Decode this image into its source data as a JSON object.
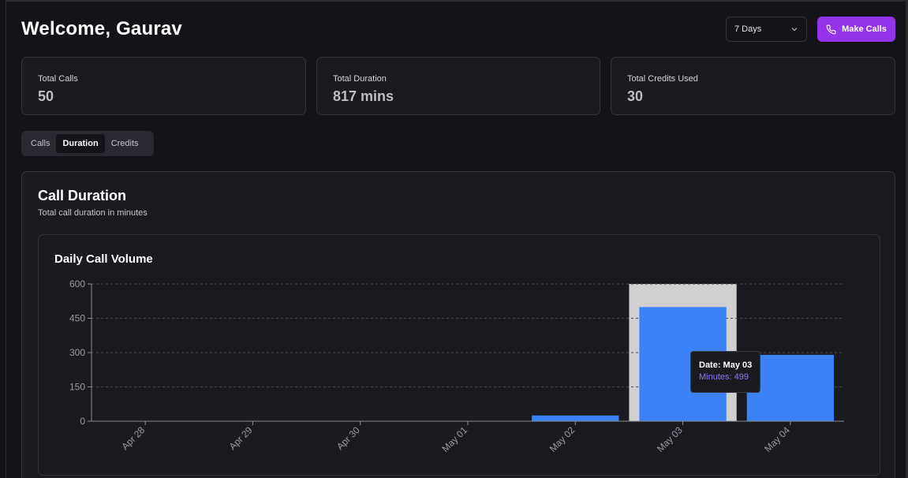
{
  "header": {
    "title": "Welcome, Gaurav",
    "range_select": "7 Days",
    "make_calls_label": "Make Calls"
  },
  "stats": [
    {
      "label": "Total Calls",
      "value": "50"
    },
    {
      "label": "Total Duration",
      "value": "817 mins"
    },
    {
      "label": "Total Credits Used",
      "value": "30"
    }
  ],
  "tabs": [
    {
      "label": "Calls",
      "active": false
    },
    {
      "label": "Duration",
      "active": true
    },
    {
      "label": "Credits",
      "active": false
    }
  ],
  "card": {
    "title": "Call Duration",
    "subtitle": "Total call duration in minutes"
  },
  "colors": {
    "accent": "#9333ea",
    "bar": "#3b82f6",
    "highlight": "#d0d0d0",
    "tooltip_value": "#8b7cf6"
  },
  "chart_data": {
    "type": "bar",
    "title": "Daily Call Volume",
    "categories": [
      "Apr 28",
      "Apr 29",
      "Apr 30",
      "May 01",
      "May 02",
      "May 03",
      "May 04"
    ],
    "values": [
      0,
      0,
      0,
      0,
      25,
      499,
      290
    ],
    "ylim": [
      0,
      600
    ],
    "yticks": [
      0,
      150,
      300,
      450,
      600
    ],
    "grid": true,
    "highlighted_category": "May 03",
    "tooltip": {
      "date_line": "Date: May 03",
      "value_line": "Minutes: 499"
    }
  }
}
